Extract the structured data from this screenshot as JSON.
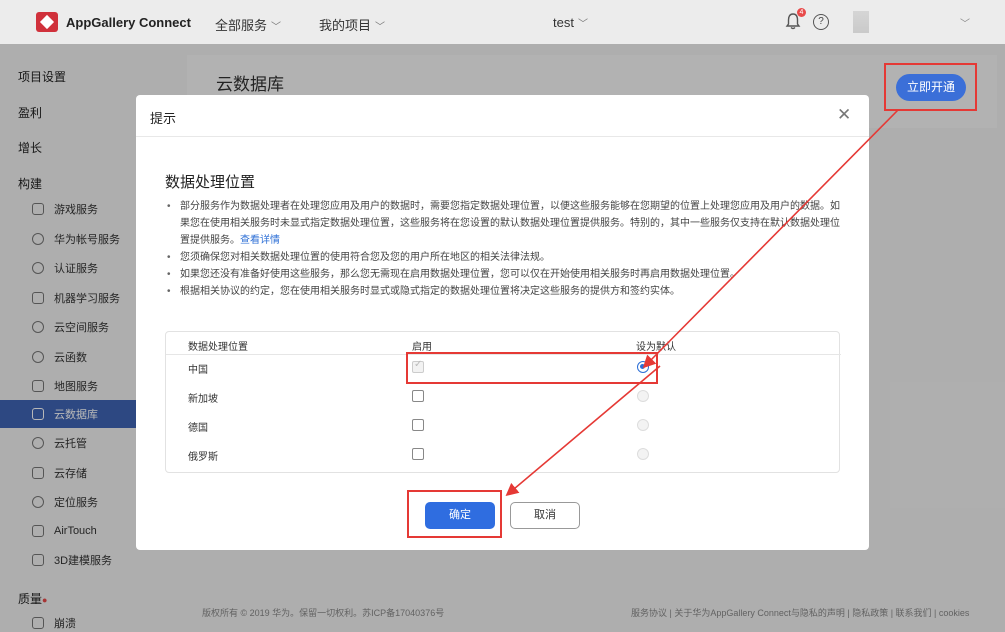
{
  "app": {
    "name": "AppGallery Connect"
  },
  "topnav": {
    "all_services": "全部服务",
    "my_projects": "我的项目",
    "project": "test",
    "notification_count": "4",
    "help": "?"
  },
  "sidebar": {
    "sections": {
      "project_settings": "项目设置",
      "monetize": "盈利",
      "grow": "增长",
      "build": "构建",
      "quality": "质量"
    },
    "items": [
      {
        "label": "游戏服务",
        "icon": "gamepad-icon"
      },
      {
        "label": "华为帐号服务",
        "icon": "user-icon"
      },
      {
        "label": "认证服务",
        "icon": "shield-icon"
      },
      {
        "label": "机器学习服务",
        "icon": "ml-icon"
      },
      {
        "label": "云空间服务",
        "icon": "leaf-icon"
      },
      {
        "label": "云函数",
        "icon": "function-icon"
      },
      {
        "label": "地图服务",
        "icon": "map-icon"
      },
      {
        "label": "云数据库",
        "icon": "database-icon"
      },
      {
        "label": "云托管",
        "icon": "hosting-icon"
      },
      {
        "label": "云存储",
        "icon": "storage-icon"
      },
      {
        "label": "定位服务",
        "icon": "location-icon"
      },
      {
        "label": "AirTouch",
        "icon": "airtouch-icon"
      },
      {
        "label": "3D建模服务",
        "icon": "grid-icon"
      }
    ],
    "quality_item": "崩溃"
  },
  "main": {
    "title": "云数据库",
    "enable_button": "立即开通"
  },
  "modal": {
    "header": "提示",
    "section_title": "数据处理位置",
    "bullets": [
      {
        "text": "部分服务作为数据处理者在处理您应用及用户的数据时，需要您指定数据处理位置，以便这些服务能够在您期望的位置上处理您应用及用户的数据。如果您在使用相关服务时未显式指定数据处理位置，这些服务将在您设置的默认数据处理位置提供服务。特别的，其中一些服务仅支持在默认数据处理位置提供服务。",
        "link": "查看详情"
      },
      {
        "text": "您须确保您对相关数据处理位置的使用符合您及您的用户所在地区的相关法律法规。"
      },
      {
        "text": "如果您还没有准备好使用这些服务，那么您无需现在启用数据处理位置，您可以仅在开始使用相关服务时再启用数据处理位置。"
      },
      {
        "text": "根据相关协议的约定，您在使用相关服务时显式或隐式指定的数据处理位置将决定这些服务的提供方和签约实体。"
      }
    ],
    "table": {
      "headers": [
        "数据处理位置",
        "启用",
        "设为默认"
      ],
      "rows": [
        {
          "location": "中国",
          "enabled": true,
          "default": true
        },
        {
          "location": "新加坡",
          "enabled": false,
          "default": false
        },
        {
          "location": "德国",
          "enabled": false,
          "default": false
        },
        {
          "location": "俄罗斯",
          "enabled": false,
          "default": false
        }
      ]
    },
    "ok_button": "确定",
    "cancel_button": "取消"
  },
  "footer": {
    "copyright": "版权所有 © 2019 华为。保留一切权利。苏ICP备17040376号",
    "links": "服务协议 | 关于华为AppGallery Connect与隐私的声明 | 隐私政策 | 联系我们 | cookies"
  },
  "colors": {
    "accent": "#2f6de0",
    "active_sidebar": "#3f64b4",
    "annotation": "#e53935"
  }
}
